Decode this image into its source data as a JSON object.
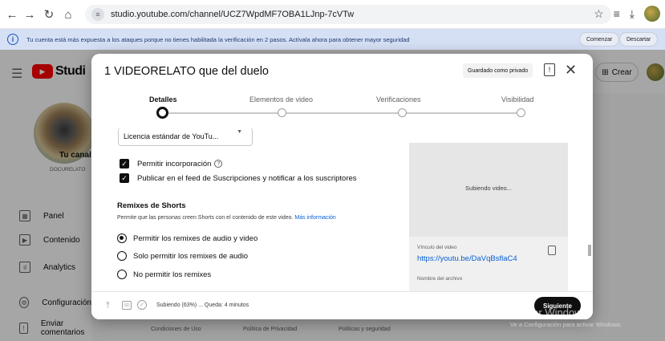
{
  "browser": {
    "url": "studio.youtube.com/channel/UCZ7WpdMF7OBA1LJnp-7cVTw"
  },
  "banner": {
    "message": "Tu cuenta está más expuesta a los ataques porque no tienes habilitada la verificación en 2 pasos. Actívala ahora para obtener mayor seguridad",
    "start_label": "Comenzar",
    "dismiss_label": "Descartar"
  },
  "header": {
    "logo_text": "Studi",
    "create_label": "Crear"
  },
  "sidebar": {
    "channel_name": "Tu canal",
    "channel_sub": "DOCURELATO",
    "items": [
      {
        "label": "Panel"
      },
      {
        "label": "Contenido"
      },
      {
        "label": "Analytics"
      },
      {
        "label": "Configuración"
      },
      {
        "label": "Enviar comentarios"
      }
    ]
  },
  "footer_links": [
    "Condiciones de Uso",
    "Política de Privacidad",
    "Políticas y seguridad"
  ],
  "modal": {
    "title": "1 VIDEORELATO que del duelo",
    "saved_badge": "Guardado como privado",
    "steps": [
      "Detalles",
      "Elementos de video",
      "Verificaciones",
      "Visibilidad"
    ],
    "active_step": 0,
    "license_value": "Licencia estándar de YouTu...",
    "checkboxes": [
      {
        "label": "Permitir incorporación",
        "checked": true
      },
      {
        "label": "Publicar en el feed de Suscripciones y notificar a los suscriptores",
        "checked": true
      }
    ],
    "remix": {
      "title": "Remixes de Shorts",
      "description": "Permite que las personas creen Shorts con el contenido de este video.",
      "more_info": "Más información",
      "options": [
        {
          "label": "Permitir los remixes de audio y video",
          "checked": true
        },
        {
          "label": "Solo permitir los remixes de audio",
          "checked": false
        },
        {
          "label": "No permitir los remixes",
          "checked": false
        }
      ]
    },
    "preview": {
      "status": "Subiendo video...",
      "link_label": "Vínculo del video",
      "link": "https://youtu.be/DaVqBsflaC4",
      "filename_label": "Nombre del archivo"
    },
    "footer": {
      "sd_label": "SD",
      "upload_status": "Subiendo (63%) ... Queda: 4 minutos",
      "upload_progress_percent": 63,
      "next_label": "Siguiente"
    }
  },
  "watermark": {
    "line1": "Activar Windows",
    "line2": "Ve a Configuración para activar Windows."
  }
}
